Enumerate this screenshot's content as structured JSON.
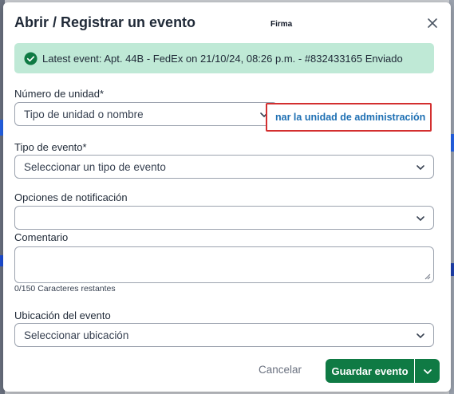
{
  "dialog": {
    "title": "Abrir / Registrar un evento",
    "firma_label": "Firma",
    "close_icon": "close-icon"
  },
  "banner": {
    "text": "Latest event: Apt. 44B - FedEx on 21/10/24, 08:26 p.m. - #832433165 Enviado",
    "icon": "check-circle-icon",
    "color": "#bfe9d6"
  },
  "unit": {
    "label": "Número de unidad*",
    "placeholder": "Tipo de unidad o nombre",
    "admin_link": "nar la unidad de administración"
  },
  "event_type": {
    "label": "Tipo de evento*",
    "placeholder": "Seleccionar un tipo de evento"
  },
  "notification": {
    "label": "Opciones de notificación",
    "value": ""
  },
  "comment": {
    "label": "Comentario",
    "counter": "0/150 Caracteres restantes"
  },
  "location": {
    "label": "Ubicación del evento",
    "placeholder": "Seleccionar ubicación"
  },
  "footer": {
    "cancel_label": "Cancelar",
    "save_label": "Guardar evento"
  },
  "colors": {
    "primary": "#0f7a44",
    "link": "#1d6fb3",
    "highlight_border": "#d32f2f"
  }
}
